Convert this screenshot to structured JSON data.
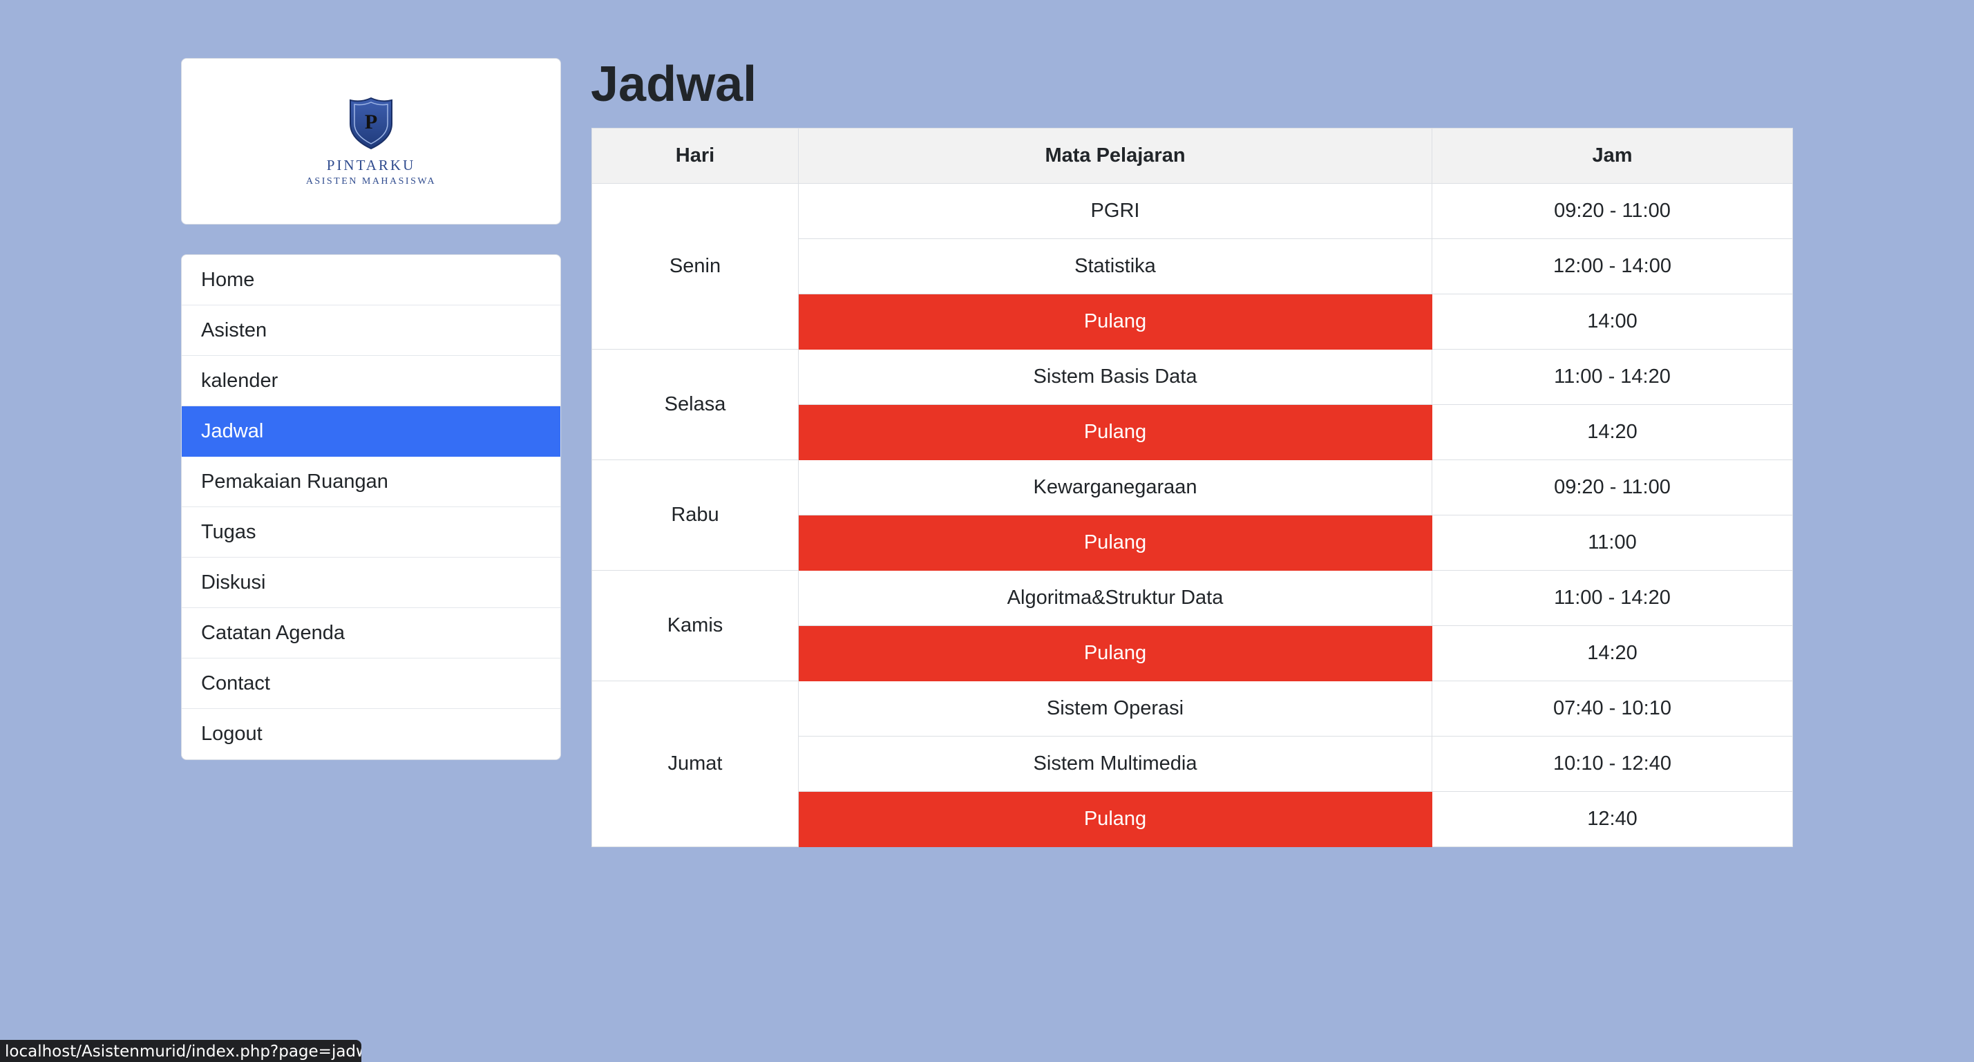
{
  "logo": {
    "letter": "P",
    "title": "PINTARKU",
    "subtitle": "ASISTEN MAHASISWA"
  },
  "sidebar": {
    "items": [
      {
        "label": "Home",
        "active": false
      },
      {
        "label": "Asisten",
        "active": false
      },
      {
        "label": "kalender",
        "active": false
      },
      {
        "label": "Jadwal",
        "active": true
      },
      {
        "label": "Pemakaian Ruangan",
        "active": false
      },
      {
        "label": "Tugas",
        "active": false
      },
      {
        "label": "Diskusi",
        "active": false
      },
      {
        "label": "Catatan Agenda",
        "active": false
      },
      {
        "label": "Contact",
        "active": false
      },
      {
        "label": "Logout",
        "active": false
      }
    ]
  },
  "main": {
    "title": "Jadwal",
    "table": {
      "headers": [
        "Hari",
        "Mata Pelajaran",
        "Jam"
      ],
      "days": [
        {
          "day": "Senin",
          "rows": [
            {
              "subject": "PGRI",
              "time": "09:20 - 11:00"
            },
            {
              "subject": "Statistika",
              "time": "12:00 - 14:00"
            },
            {
              "subject": "Pulang",
              "time": "14:00"
            }
          ]
        },
        {
          "day": "Selasa",
          "rows": [
            {
              "subject": "Sistem Basis Data",
              "time": "11:00 - 14:20"
            },
            {
              "subject": "Pulang",
              "time": "14:20"
            }
          ]
        },
        {
          "day": "Rabu",
          "rows": [
            {
              "subject": "Kewarganegaraan",
              "time": "09:20 - 11:00"
            },
            {
              "subject": "Pulang",
              "time": "11:00"
            }
          ]
        },
        {
          "day": "Kamis",
          "rows": [
            {
              "subject": "Algoritma&Struktur Data",
              "time": "11:00 - 14:20"
            },
            {
              "subject": "Pulang",
              "time": "14:20"
            }
          ]
        },
        {
          "day": "Jumat",
          "rows": [
            {
              "subject": "Sistem Operasi",
              "time": "07:40 - 10:10"
            },
            {
              "subject": "Sistem Multimedia",
              "time": "10:10 - 12:40"
            },
            {
              "subject": "Pulang",
              "time": "12:40"
            }
          ]
        }
      ]
    }
  },
  "status_bar": {
    "url": "localhost/Asistenmurid/index.php?page=jadwal"
  },
  "colors": {
    "background": "#9fb2da",
    "active_nav": "#356ef5",
    "pulang": "#e93425",
    "logo_blue": "#2f4b8e"
  }
}
